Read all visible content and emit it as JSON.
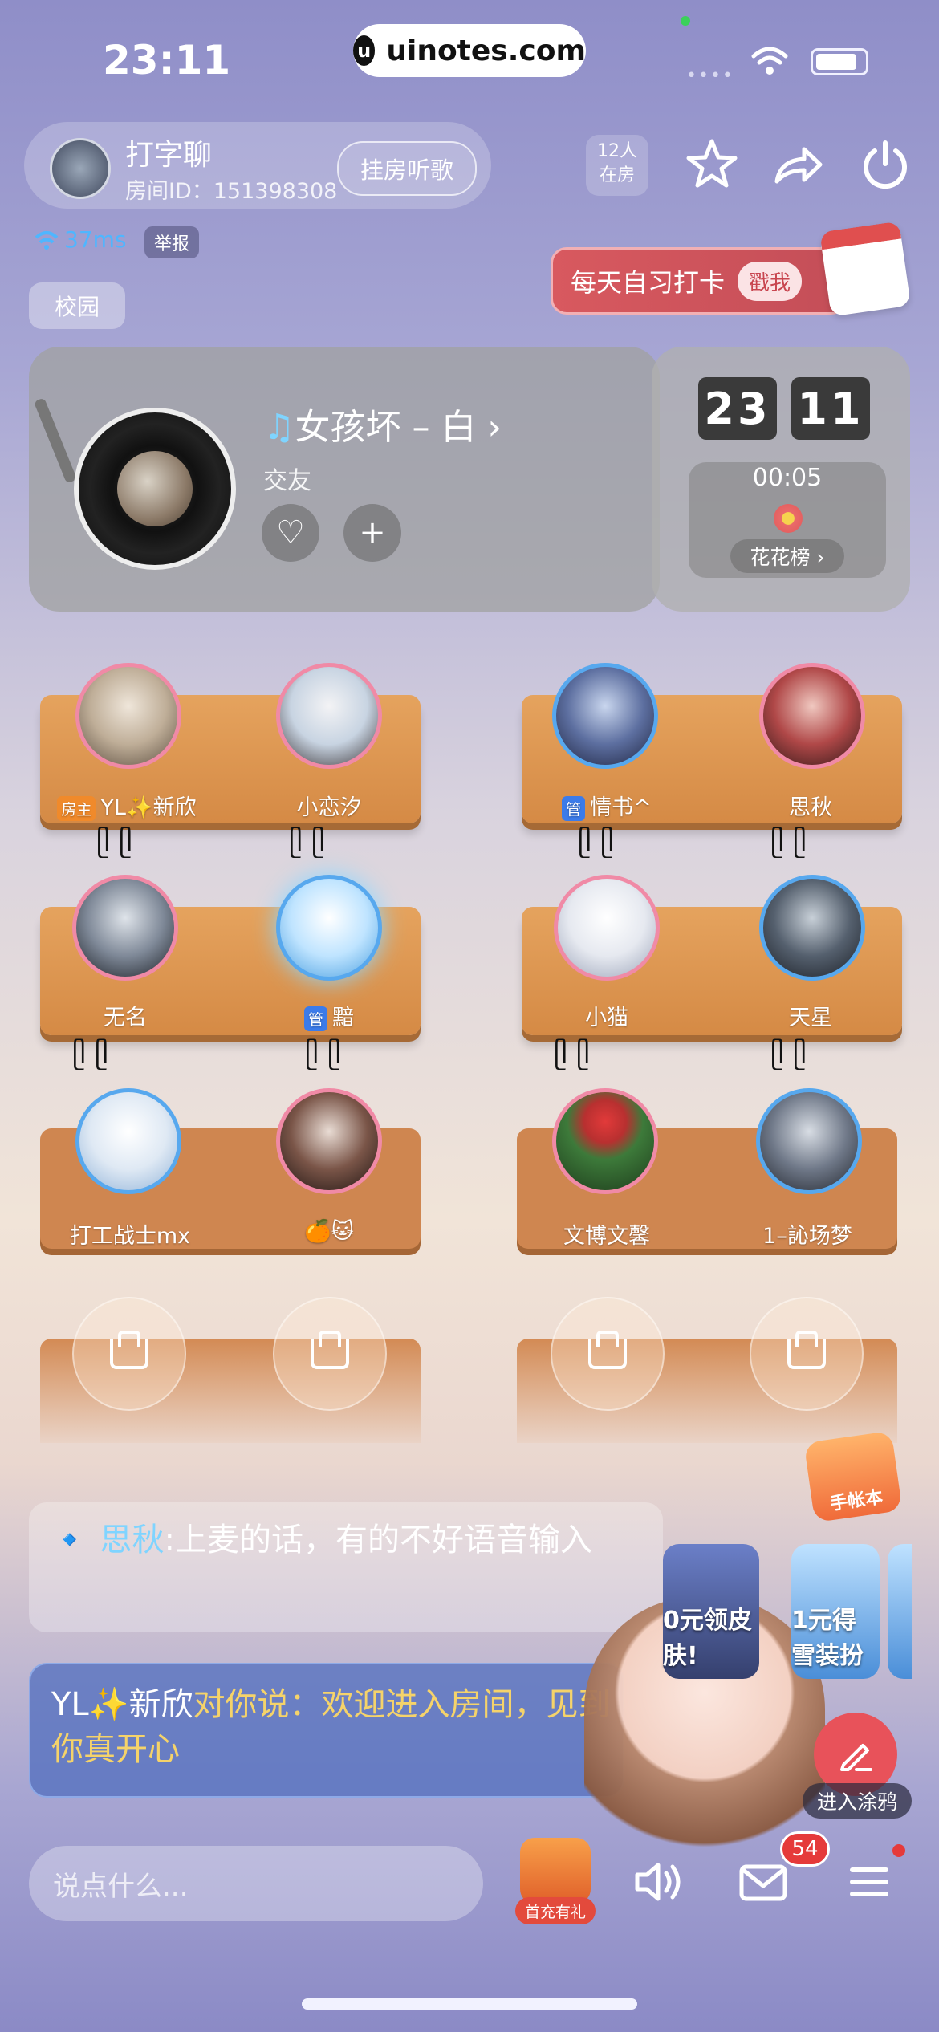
{
  "status_bar": {
    "time": "23:11",
    "url": "uinotes.com",
    "url_logo": "u"
  },
  "room": {
    "name": "打字聊",
    "id_text": "房间ID：151398308",
    "listen_button": "挂房听歌",
    "online": [
      "12人",
      "在房"
    ],
    "ping": "37ms",
    "report": "举报",
    "category": "校园",
    "checkin_text": "每天自习打卡",
    "checkin_stamp": "戳我"
  },
  "music": {
    "title": "女孩坏 – 白",
    "tag": "交友",
    "like_icon": "♡",
    "add_icon": "+"
  },
  "clock": {
    "hour": "23",
    "minute": "11",
    "timer": "00:05",
    "rank": "花花榜 ›"
  },
  "seats": [
    {
      "name": "YL✨新欣",
      "badge": "房主"
    },
    {
      "name": "小恋汐"
    },
    {
      "name": "情书^",
      "badge": "管"
    },
    {
      "name": "思秋"
    },
    {
      "name": "无名"
    },
    {
      "name": "黯",
      "badge": "管"
    },
    {
      "name": "小猫"
    },
    {
      "name": "天星"
    },
    {
      "name": "打工战士mx"
    },
    {
      "name": "🍊🐱"
    },
    {
      "name": "文博文馨"
    },
    {
      "name": "1–訫场梦"
    }
  ],
  "chat": {
    "msg1_name": "思秋",
    "msg1_sep": ":",
    "msg1_text": "上麦的话，有的不好语音输入",
    "msg2_name": "YL✨新欣",
    "msg2_text": "对你说：欢迎进入房间，见到你真开心"
  },
  "floating": {
    "ledger": "手帐本",
    "promo1": "0元领皮肤!",
    "promo2": "1元得雪装扮",
    "doodle": "进入涂鸦"
  },
  "bottom_bar": {
    "placeholder": "说点什么...",
    "gift_label": "首充有礼",
    "mail_count": "54"
  },
  "colors": {
    "accent_red": "#e8525a",
    "ping_blue": "#4fb6ff",
    "chat_name_blue": "#7fd4ff",
    "chat_gold": "#f5d36a"
  }
}
